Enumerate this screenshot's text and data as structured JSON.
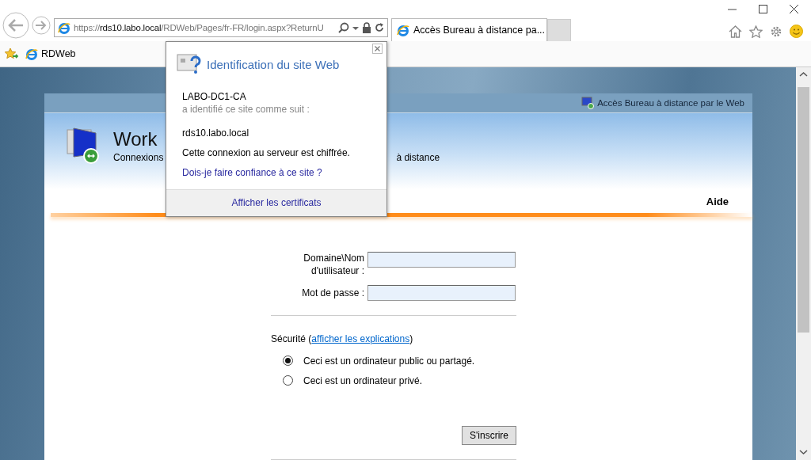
{
  "browser": {
    "address": "https://**rds10.labo.local**/RDWeb/Pages/fr-FR/login.aspx?ReturnU",
    "tabs": [
      {
        "title": "Accès Bureau à distance pa...",
        "selected": true
      }
    ],
    "favorites": [
      {
        "label": "RDWeb"
      }
    ]
  },
  "page": {
    "header_link": "Accès Bureau à distance par le Web",
    "title": "Work",
    "subtitle": [
      "Connexions",
      "à distance"
    ],
    "help": "Aide",
    "form": {
      "username_label": "Domaine\\Nom d'utilisateur :",
      "password_label": "Mot de passe :",
      "security": {
        "prefix": "Sécurité (",
        "link": "afficher les explications",
        "suffix": ")"
      },
      "radios": [
        {
          "label": "Ceci est un ordinateur public ou partagé.",
          "selected": true
        },
        {
          "label": "Ceci est un ordinateur privé.",
          "selected": false
        }
      ],
      "submit": "S'inscrire"
    }
  },
  "popup": {
    "title": "Identification du site Web",
    "issuer": "LABO-DC1-CA",
    "issuer_note": "a identifié ce site comme suit :",
    "site": "rds10.labo.local",
    "status": "Cette connexion au serveur est chiffrée.",
    "trust_link": "Dois-je faire confiance à ce site ?",
    "footer_link": "Afficher les certificats"
  }
}
